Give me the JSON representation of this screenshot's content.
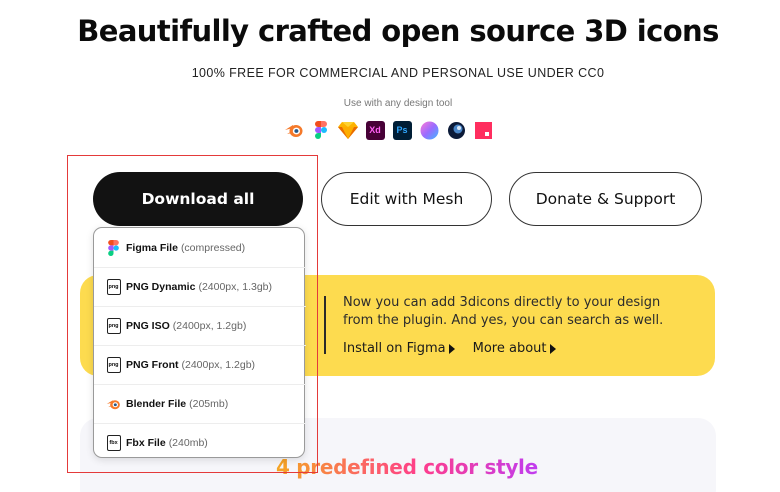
{
  "hero": {
    "title": "Beautifully crafted open source 3D icons",
    "subtitle": "100% FREE FOR COMMERCIAL AND PERSONAL USE UNDER CC0",
    "tools_caption": "Use with any design tool"
  },
  "tools": [
    {
      "icon": "blender-icon"
    },
    {
      "icon": "figma-icon"
    },
    {
      "icon": "sketch-icon"
    },
    {
      "icon": "adobe-xd-icon",
      "label": "Xd",
      "bg": "#470137",
      "fg": "#ff61f6"
    },
    {
      "icon": "photoshop-icon",
      "label": "Ps",
      "bg": "#001e36",
      "fg": "#31a8ff"
    },
    {
      "icon": "framer-icon"
    },
    {
      "icon": "cinema4d-icon"
    },
    {
      "icon": "craft-icon"
    }
  ],
  "buttons": {
    "download": "Download all",
    "mesh": "Edit with Mesh",
    "donate": "Donate & Support"
  },
  "dropdown": [
    {
      "name": "Figma File",
      "meta": "(compressed)",
      "icon": "figma-icon"
    },
    {
      "name": "PNG Dynamic",
      "meta": "(2400px, 1.3gb)",
      "icon": "png-file-icon",
      "badge": "png"
    },
    {
      "name": "PNG ISO",
      "meta": "(2400px, 1.2gb)",
      "icon": "png-file-icon",
      "badge": "png"
    },
    {
      "name": "PNG Front",
      "meta": "(2400px, 1.2gb)",
      "icon": "png-file-icon",
      "badge": "png"
    },
    {
      "name": "Blender File",
      "meta": "(205mb)",
      "icon": "blender-icon"
    },
    {
      "name": "Fbx File",
      "meta": "(240mb)",
      "icon": "fbx-file-icon",
      "badge": "fbx"
    }
  ],
  "plugin": {
    "line1": "Now you can add 3dicons directly to your design",
    "line2": "from the plugin. And yes, you can search as well.",
    "install_link": "Install on Figma",
    "more_link": "More about"
  },
  "colors_section": {
    "title": "4 predefined color style"
  },
  "theme": {
    "banner_color": "#fddb4f",
    "highlight_color": "#e43a3a",
    "button_dark": "#121212"
  }
}
